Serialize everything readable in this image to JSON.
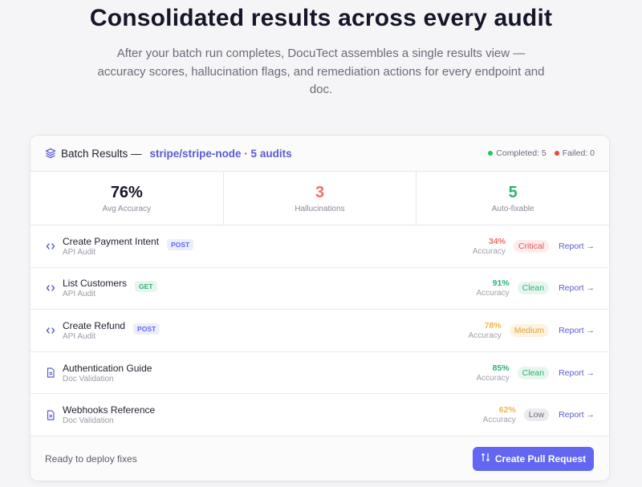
{
  "hero": {
    "title": "Consolidated results across every audit",
    "subtitle": "After your batch run completes, DocuTect assembles a single results view — accuracy scores, hallucination flags, and remediation actions for every endpoint and doc."
  },
  "card": {
    "title": "Batch Results —",
    "repo": "stripe/stripe-node · 5 audits",
    "icon": "stack-icon",
    "completed": "Completed: 5",
    "failed": "Failed: 0",
    "completed_color": "#22c55e",
    "failed_color": "#ef4444"
  },
  "stats": [
    {
      "value": "76%",
      "label": "Avg Accuracy",
      "color": "#16162a"
    },
    {
      "value": "3",
      "label": "Hallucinations",
      "color": "#f26d6d"
    },
    {
      "value": "5",
      "label": "Auto-fixable",
      "color": "#2fb172"
    }
  ],
  "rows": [
    {
      "icon": "code-icon",
      "title": "Create Payment Intent",
      "type": "API Audit",
      "method": "POST",
      "accuracy": "34%",
      "accuracy_label": "Accuracy",
      "status": "Critical",
      "report": "Report →",
      "tone": "critical"
    },
    {
      "icon": "code-icon",
      "title": "List Customers",
      "type": "API Audit",
      "method": "GET",
      "accuracy": "91%",
      "accuracy_label": "Accuracy",
      "status": "Clean",
      "report": "Report →",
      "tone": "clean"
    },
    {
      "icon": "code-icon",
      "title": "Create Refund",
      "type": "API Audit",
      "method": "POST",
      "accuracy": "78%",
      "accuracy_label": "Accuracy",
      "status": "Medium",
      "report": "Report →",
      "tone": "medium"
    },
    {
      "icon": "doc-icon",
      "title": "Authentication Guide",
      "type": "Doc Validation",
      "method": "",
      "accuracy": "85%",
      "accuracy_label": "Accuracy",
      "status": "Clean",
      "report": "Report →",
      "tone": "clean"
    },
    {
      "icon": "doc-icon",
      "title": "Webhooks Reference",
      "type": "Doc Validation",
      "method": "",
      "accuracy": "62%",
      "accuracy_label": "Accuracy",
      "status": "Low",
      "report": "Report →",
      "tone": "low"
    }
  ],
  "footer": {
    "text": "Ready to deploy fixes",
    "button": "Create Pull Request",
    "button_icon": "pull-request-icon"
  },
  "colors": {
    "accent": "#6366f1",
    "critical": "#f26d6d",
    "clean": "#2fb172",
    "medium": "#f5b642",
    "low": "#f5b642",
    "post": "#6366f1",
    "get": "#2fb172"
  }
}
